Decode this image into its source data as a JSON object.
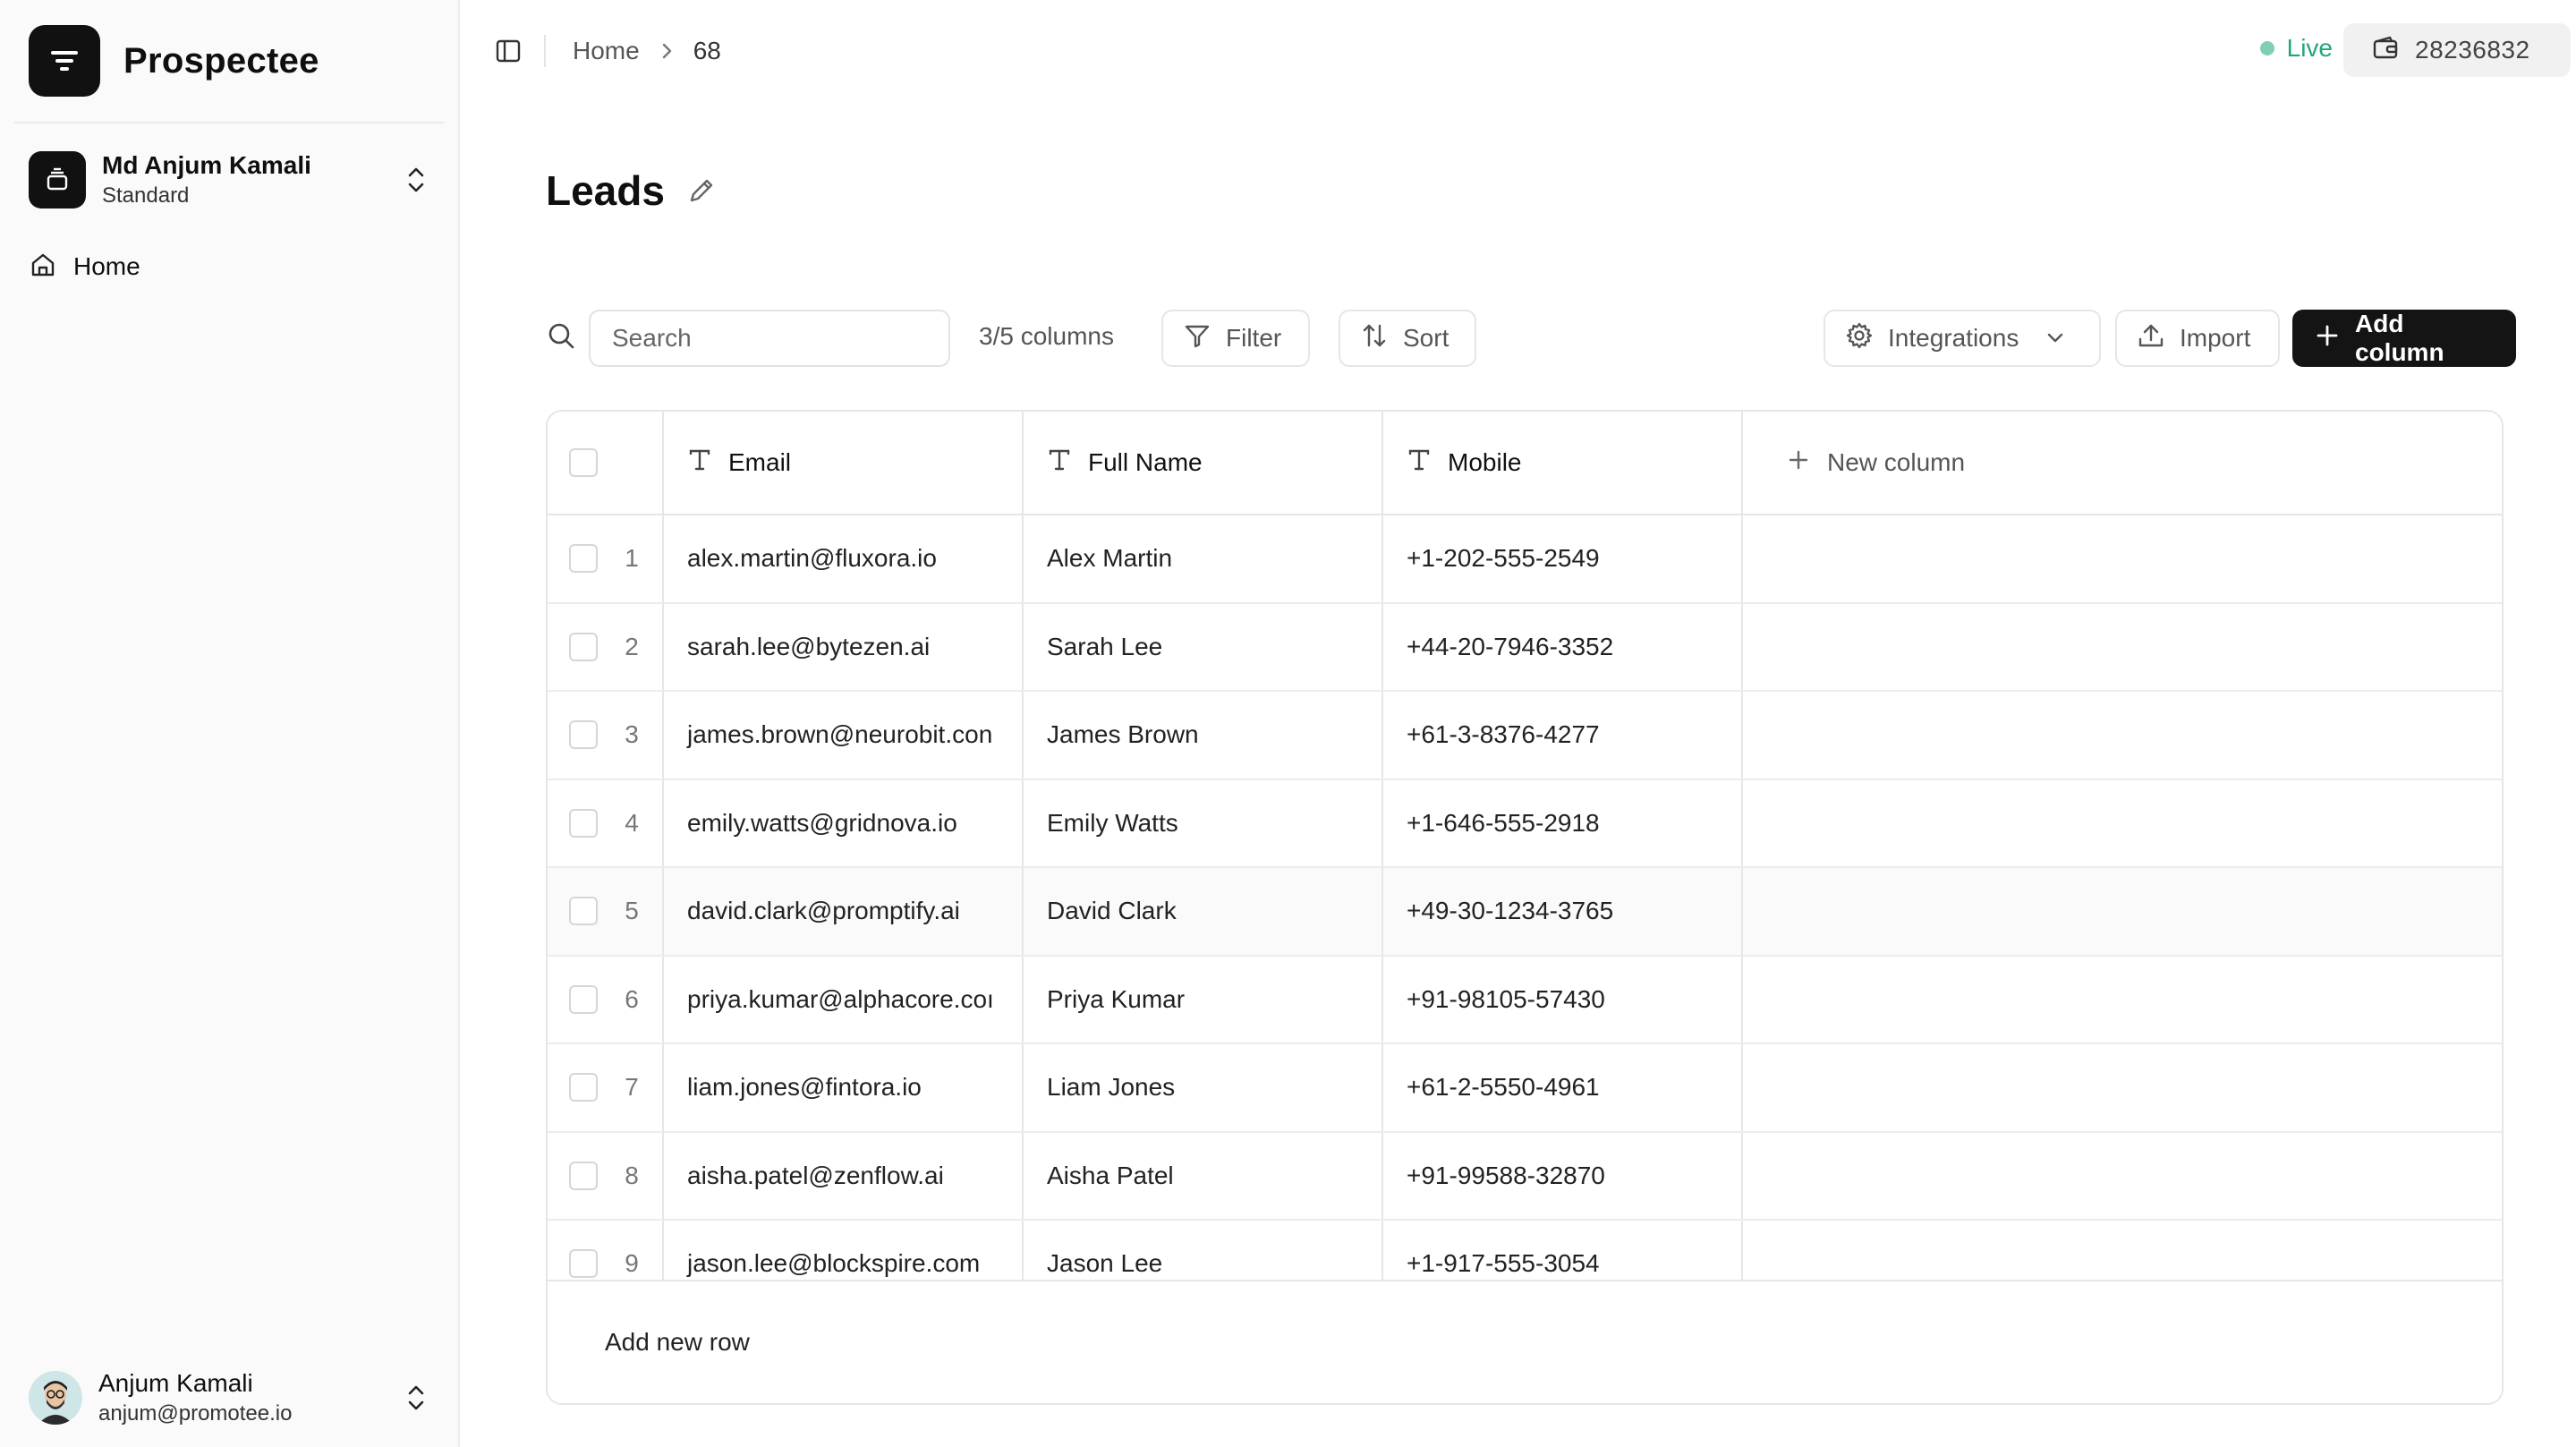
{
  "brand": {
    "name": "Prospectee"
  },
  "account": {
    "name": "Md Anjum Kamali",
    "plan": "Standard"
  },
  "nav": {
    "items": [
      {
        "label": "Home",
        "icon": "home-icon"
      }
    ]
  },
  "user": {
    "name": "Anjum Kamali",
    "email": "anjum@promotee.io"
  },
  "topbar": {
    "breadcrumb": {
      "home": "Home",
      "current": "68"
    },
    "status": {
      "label": "Live",
      "color": "#21a67a"
    },
    "credits": "28236832"
  },
  "page": {
    "title": "Leads"
  },
  "toolbar": {
    "search_placeholder": "Search",
    "columns_count": "3/5 columns",
    "filter_label": "Filter",
    "sort_label": "Sort",
    "integrations_label": "Integrations",
    "import_label": "Import",
    "add_column_label": "Add column"
  },
  "table": {
    "columns": [
      {
        "label": "Email",
        "icon": "text-type-icon"
      },
      {
        "label": "Full Name",
        "icon": "text-type-icon"
      },
      {
        "label": "Mobile",
        "icon": "text-type-icon"
      }
    ],
    "new_column_label": "New column",
    "rows": [
      {
        "n": "1",
        "email": "alex.martin@fluxora.io",
        "name": "Alex Martin",
        "mobile": "+1-202-555-2549"
      },
      {
        "n": "2",
        "email": "sarah.lee@bytezen.ai",
        "name": "Sarah Lee",
        "mobile": "+44-20-7946-3352"
      },
      {
        "n": "3",
        "email": "james.brown@neurobit.con",
        "name": "James Brown",
        "mobile": "+61-3-8376-4277"
      },
      {
        "n": "4",
        "email": "emily.watts@gridnova.io",
        "name": "Emily Watts",
        "mobile": "+1-646-555-2918"
      },
      {
        "n": "5",
        "email": "david.clark@promptify.ai",
        "name": "David Clark",
        "mobile": "+49-30-1234-3765"
      },
      {
        "n": "6",
        "email": "priya.kumar@alphacore.coı",
        "name": "Priya Kumar",
        "mobile": "+91-98105-57430"
      },
      {
        "n": "7",
        "email": "liam.jones@fintora.io",
        "name": "Liam Jones",
        "mobile": "+61-2-5550-4961"
      },
      {
        "n": "8",
        "email": "aisha.patel@zenflow.ai",
        "name": "Aisha Patel",
        "mobile": "+91-99588-32870"
      },
      {
        "n": "9",
        "email": "jason.lee@blockspire.com",
        "name": "Jason Lee",
        "mobile": "+1-917-555-3054"
      }
    ],
    "add_row_label": "Add new row"
  }
}
